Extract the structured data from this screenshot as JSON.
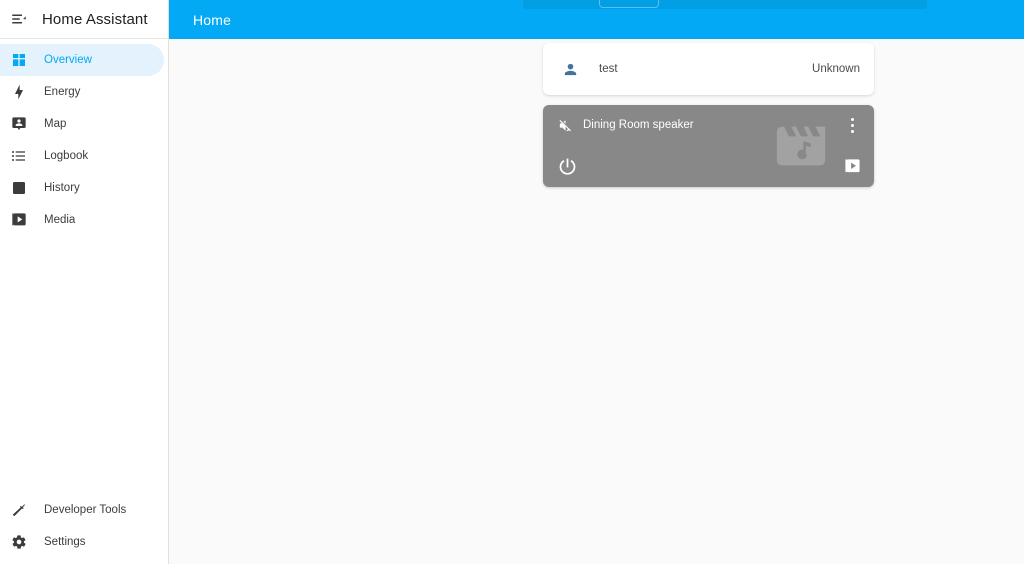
{
  "app": {
    "title": "Home Assistant",
    "menu_icon": "menu-open-icon",
    "accent_color": "#03a9f4",
    "background_color": "#fafafa"
  },
  "sidebar": {
    "items": [
      {
        "label": "Overview",
        "icon": "view-dashboard-icon",
        "active": true
      },
      {
        "label": "Energy",
        "icon": "lightning-bolt-icon",
        "active": false
      },
      {
        "label": "Map",
        "icon": "map-marker-account-icon",
        "active": false
      },
      {
        "label": "Logbook",
        "icon": "format-list-bulleted-icon",
        "active": false
      },
      {
        "label": "History",
        "icon": "chart-box-icon",
        "active": false
      },
      {
        "label": "Media",
        "icon": "play-box-multiple-icon",
        "active": false
      }
    ],
    "bottom_items": [
      {
        "label": "Developer Tools",
        "icon": "hammer-icon"
      },
      {
        "label": "Settings",
        "icon": "gear-icon"
      }
    ]
  },
  "toolbar": {
    "title": "Home"
  },
  "cards": {
    "entities_card": {
      "rows": [
        {
          "name": "test",
          "state": "Unknown",
          "icon": "account-icon",
          "icon_color": "#44739e"
        }
      ]
    },
    "media_card": {
      "title": "Dining Room speaker",
      "mute_icon": "volume-off-icon",
      "more_icon": "dots-vertical-icon",
      "power_icon": "power-icon",
      "browse_icon": "play-box-multiple-icon",
      "artwork_placeholder_icon": "movie-music-icon",
      "background_color": "#888888"
    }
  }
}
